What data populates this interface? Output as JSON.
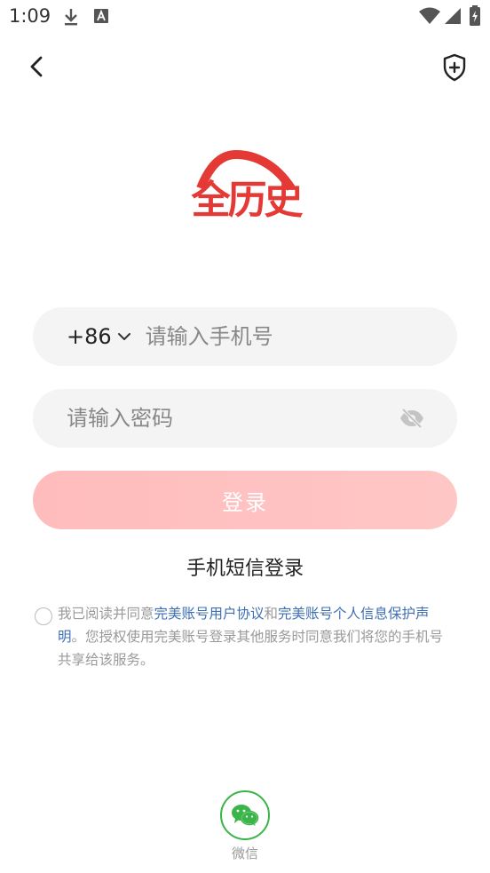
{
  "status_bar": {
    "time": "1:09",
    "icons": [
      "download-icon",
      "a-icon",
      "wifi-icon",
      "signal-icon",
      "battery-icon"
    ]
  },
  "header": {
    "back_icon": "chevron-left-icon",
    "shield_icon": "shield-plus-icon"
  },
  "logo": {
    "text": "全历史",
    "color": "#e53935"
  },
  "form": {
    "country_code": "+86",
    "phone_placeholder": "请输入手机号",
    "password_placeholder": "请输入密码",
    "login_label": "登录",
    "sms_login_label": "手机短信登录"
  },
  "agreement": {
    "prefix": "我已阅读并同意",
    "link_user": "完美账号用户协议",
    "and": "和",
    "link_privacy": "完美账号个人信息保护声明",
    "suffix": "。您授权使用完美账号登录其他服务时同意我们将您的手机号共享给该服务。"
  },
  "social": {
    "wechat_label": "微信",
    "wechat_color": "#3bb44a"
  },
  "colors": {
    "accent": "#e53935",
    "button": "#ffc0c0",
    "link": "#3e6fb3",
    "field_bg": "#f4f4f4"
  }
}
